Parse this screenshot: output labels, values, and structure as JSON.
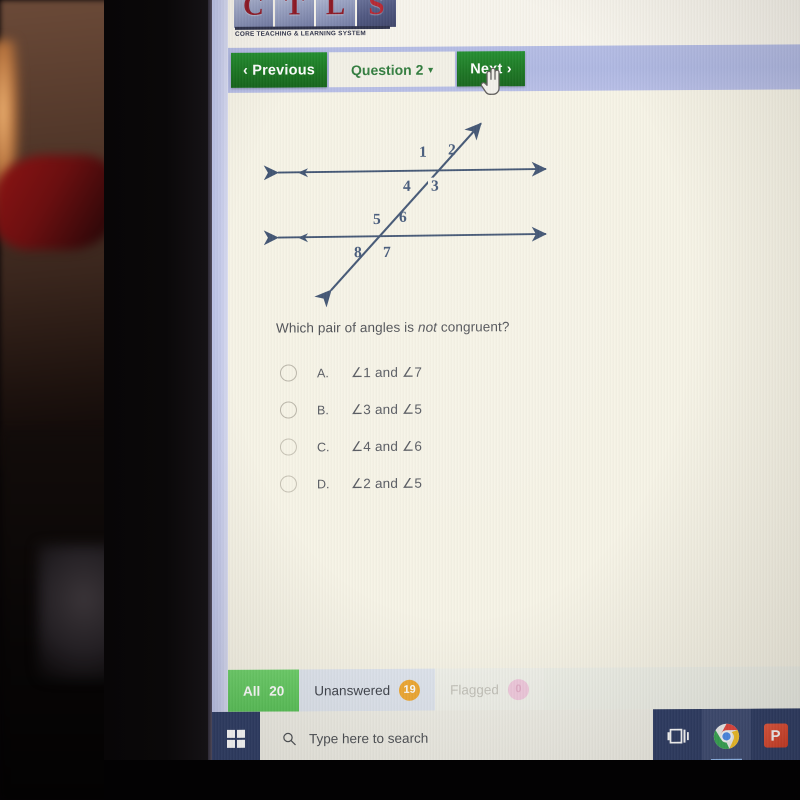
{
  "logo": {
    "letters": [
      "C",
      "T",
      "L",
      "S"
    ],
    "subtitle": "CORE TEACHING & LEARNING SYSTEM"
  },
  "nav": {
    "previous_label": "‹ Previous",
    "question_label": "Question 2",
    "question_caret": "▾",
    "next_label": "Next ›"
  },
  "cursor": {
    "name": "hand-pointer-cursor"
  },
  "figure": {
    "description": "Two parallel horizontal lines cut by a transversal, with eight numbered angles",
    "angle_labels": [
      "1",
      "2",
      "3",
      "4",
      "5",
      "6",
      "7",
      "8"
    ],
    "line_color": "#3d5170"
  },
  "question": {
    "text_before": "Which pair of angles is ",
    "emphasis": "not",
    "text_after": " congruent?"
  },
  "options": [
    {
      "letter": "A.",
      "text": "∠1 and ∠7",
      "selected": false
    },
    {
      "letter": "B.",
      "text": "∠3 and ∠5",
      "selected": false
    },
    {
      "letter": "C.",
      "text": "∠4 and ∠6",
      "selected": false
    },
    {
      "letter": "D.",
      "text": "∠2 and ∠5",
      "selected": false
    }
  ],
  "filters": [
    {
      "label": "All",
      "count": "20",
      "state": "active"
    },
    {
      "label": "Unanswered",
      "count": "19",
      "state": "normal"
    },
    {
      "label": "Flagged",
      "count": "0",
      "state": "disabled"
    }
  ],
  "taskbar": {
    "search_placeholder": "Type here to search",
    "icons": [
      "task-view-icon",
      "chrome-icon",
      "powerpoint-icon"
    ],
    "powerpoint_letter": "P"
  },
  "colors": {
    "green": "#17741f",
    "navbar": "#aeb7e2",
    "page_bg": "#f6f3e6",
    "badge_orange": "#efa831",
    "badge_pink": "#f0c9dd",
    "taskbar_blue": "#2b3a63"
  }
}
